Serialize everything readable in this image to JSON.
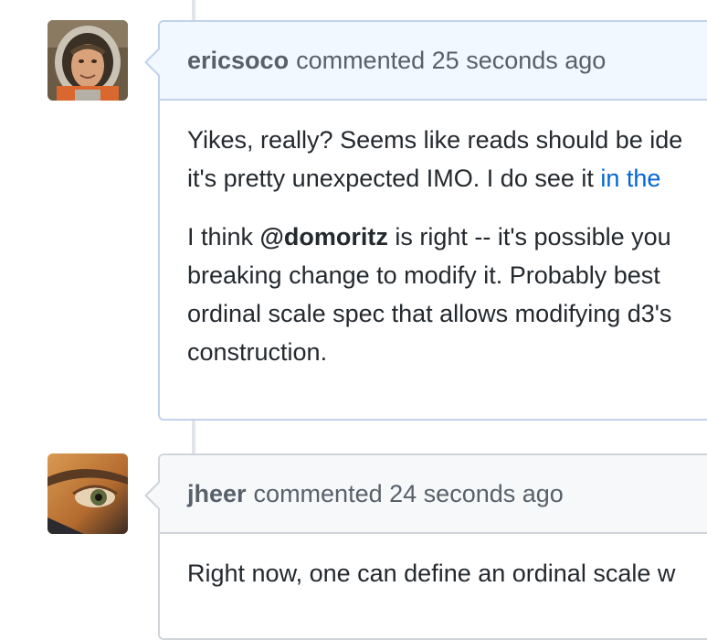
{
  "comments": [
    {
      "author": "ericsoco",
      "action": "commented",
      "time": "25 seconds ago",
      "paragraphs": {
        "p1": {
          "line1": "Yikes, really? Seems like reads should be ide",
          "line2_before": "it's pretty unexpected IMO. I do see it ",
          "line2_link": "in the"
        },
        "p2": {
          "line1_before": "I think ",
          "line1_mention": "@domoritz",
          "line1_after": " is right -- it's possible you",
          "line2": "breaking change to modify it. Probably best ",
          "line3": "ordinal scale spec that allows modifying d3's",
          "line4": "construction."
        }
      }
    },
    {
      "author": "jheer",
      "action": "commented",
      "time": "24 seconds ago",
      "paragraphs": {
        "p1": {
          "line1": "Right now, one can define an ordinal scale w"
        }
      }
    }
  ],
  "colors": {
    "header_blue_bg": "#f1f8ff",
    "header_gray_bg": "#f6f8fa",
    "link": "#0366d6",
    "muted_text": "#586069"
  }
}
